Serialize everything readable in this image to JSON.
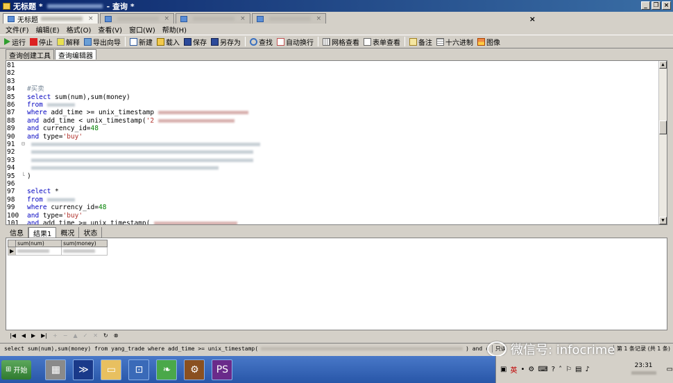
{
  "window": {
    "title": "无标题 *",
    "title_suffix": "- 查询 *"
  },
  "doc_tabs": [
    {
      "label": "无标题"
    }
  ],
  "menu": [
    "文件(F)",
    "编辑(E)",
    "格式(O)",
    "查看(V)",
    "窗口(W)",
    "帮助(H)"
  ],
  "toolbar": [
    {
      "icon": "run-icon",
      "label": "运行"
    },
    {
      "icon": "stop-icon",
      "label": "停止"
    },
    {
      "icon": "explain-icon",
      "label": "解释"
    },
    {
      "icon": "export-wizard-icon",
      "label": "导出向导"
    },
    {
      "icon": "new-icon",
      "label": "新建"
    },
    {
      "icon": "load-icon",
      "label": "载入"
    },
    {
      "icon": "save-icon",
      "label": "保存"
    },
    {
      "icon": "save-as-icon",
      "label": "另存为"
    },
    {
      "icon": "find-icon",
      "label": "查找"
    },
    {
      "icon": "word-wrap-icon",
      "label": "自动换行"
    },
    {
      "icon": "grid-view-icon",
      "label": "网格查看"
    },
    {
      "icon": "form-view-icon",
      "label": "表单查看"
    },
    {
      "icon": "memo-icon",
      "label": "备注"
    },
    {
      "icon": "hex-icon",
      "label": "十六进制"
    },
    {
      "icon": "image-icon",
      "label": "图像"
    }
  ],
  "sub_tabs": [
    "查询创建工具",
    "查询编辑器"
  ],
  "editor": {
    "lines": [
      {
        "n": "81",
        "code": ""
      },
      {
        "n": "82",
        "code": ""
      },
      {
        "n": "83",
        "code": ""
      },
      {
        "n": "84",
        "code": "#买卖"
      },
      {
        "n": "85",
        "code": "select sum(num),sum(money)"
      },
      {
        "n": "86",
        "code": "from"
      },
      {
        "n": "87",
        "code": "where add_time >= unix_timestamp"
      },
      {
        "n": "88",
        "code": "and add_time < unix_timestamp('2"
      },
      {
        "n": "89",
        "code": "and currency_id=48"
      },
      {
        "n": "90",
        "code": "and type='buy'"
      },
      {
        "n": "91",
        "code": ""
      },
      {
        "n": "92",
        "code": ""
      },
      {
        "n": "93",
        "code": ""
      },
      {
        "n": "94",
        "code": ""
      },
      {
        "n": "95",
        "code": ")"
      },
      {
        "n": "96",
        "code": ""
      },
      {
        "n": "97",
        "code": "select *"
      },
      {
        "n": "98",
        "code": "from"
      },
      {
        "n": "99",
        "code": "where currency_id=48"
      },
      {
        "n": "100",
        "code": "and type='buy'"
      },
      {
        "n": "101",
        "code": "and add time >= unix timestamp("
      }
    ]
  },
  "result_tabs": [
    "信息",
    "结果1",
    "概况",
    "状态"
  ],
  "grid": {
    "columns": [
      "sum(num)",
      "sum(money)"
    ]
  },
  "status": {
    "sql_prefix": "select sum(num),sum(money) from yang_trade where add_time >= unix_timestamp(",
    "sql_suffix": ") and c",
    "readonly": "只读",
    "extra": "第 1 条记录 (共 1 条)"
  },
  "watermark": "微信号: infocrime",
  "taskbar": {
    "start": "开始",
    "clock": "23:31",
    "ime": "英"
  }
}
